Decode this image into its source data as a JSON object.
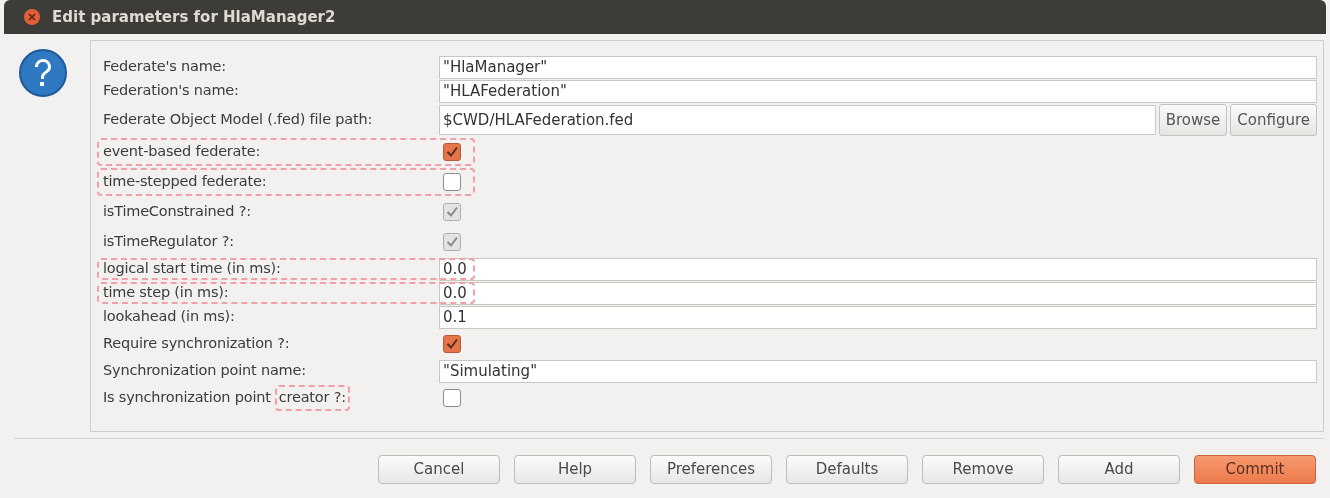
{
  "window": {
    "title": "Edit parameters for HlaManager2"
  },
  "parameters": [
    {
      "kind": "text",
      "label": "Federate's name:",
      "value": "\"HlaManager\"",
      "highlighted": false
    },
    {
      "kind": "text",
      "label": "Federation's name:",
      "value": "\"HLAFederation\"",
      "highlighted": false
    },
    {
      "kind": "file",
      "label": "Federate Object Model (.fed) file path:",
      "value": "$CWD/HLAFederation.fed",
      "buttons": [
        "Browse",
        "Configure"
      ],
      "highlighted": false
    },
    {
      "kind": "checkbox",
      "label": "event-based federate:",
      "checked": true,
      "disabled": false,
      "highlighted": true
    },
    {
      "kind": "checkbox",
      "label": "time-stepped federate:",
      "checked": false,
      "disabled": false,
      "highlighted": true
    },
    {
      "kind": "checkbox",
      "label": "isTimeConstrained ?:",
      "checked": true,
      "disabled": true,
      "highlighted": false
    },
    {
      "kind": "checkbox",
      "label": "isTimeRegulator ?:",
      "checked": true,
      "disabled": true,
      "highlighted": false
    },
    {
      "kind": "text",
      "label": "logical start time (in ms):",
      "value": "0.0",
      "highlighted": true
    },
    {
      "kind": "text",
      "label": "time step (in ms):",
      "value": "0.0",
      "highlighted": true
    },
    {
      "kind": "text",
      "label": "lookahead (in ms):",
      "value": "0.1",
      "highlighted": false
    },
    {
      "kind": "checkbox",
      "label": "Require synchronization ?:",
      "checked": true,
      "disabled": false,
      "highlighted": false
    },
    {
      "kind": "text",
      "label": "Synchronization point name:",
      "value": "\"Simulating\"",
      "highlighted": false
    },
    {
      "kind": "checkbox",
      "label": "Is synchronization point",
      "highlighted_label": "creator ?:",
      "checked": false,
      "disabled": false,
      "highlighted": false
    }
  ],
  "buttons": [
    {
      "label": "Cancel",
      "default": false
    },
    {
      "label": "Help",
      "default": false
    },
    {
      "label": "Preferences",
      "default": false
    },
    {
      "label": "Defaults",
      "default": false
    },
    {
      "label": "Remove",
      "default": false
    },
    {
      "label": "Add",
      "default": false
    },
    {
      "label": "Commit",
      "default": true
    }
  ]
}
